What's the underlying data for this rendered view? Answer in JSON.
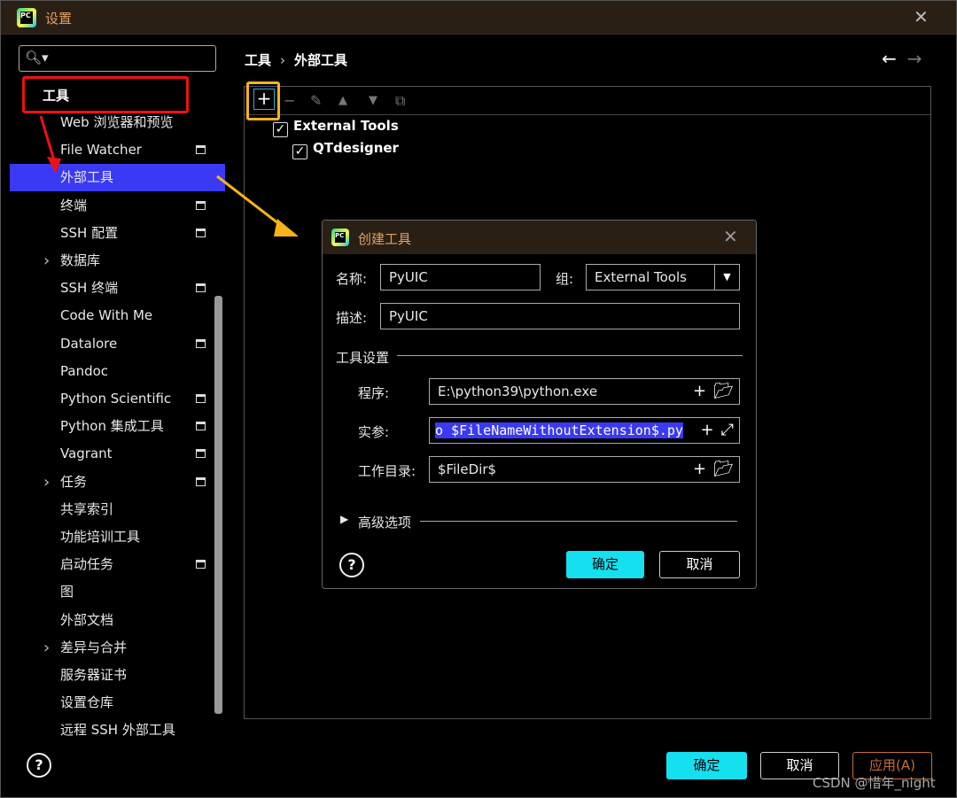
{
  "window": {
    "title": "设置",
    "close": "✕"
  },
  "search": {
    "placeholder": "",
    "icon": "search-icon"
  },
  "sidebar": {
    "heading": "工具",
    "items": [
      {
        "label": "Web 浏览器和预览",
        "chev": false,
        "badge": false
      },
      {
        "label": "File Watcher",
        "chev": false,
        "badge": true
      },
      {
        "label": "外部工具",
        "chev": false,
        "badge": false,
        "selected": true
      },
      {
        "label": "终端",
        "chev": false,
        "badge": true
      },
      {
        "label": "SSH 配置",
        "chev": false,
        "badge": true
      },
      {
        "label": "数据库",
        "chev": true,
        "badge": false
      },
      {
        "label": "SSH 终端",
        "chev": false,
        "badge": true
      },
      {
        "label": "Code With Me",
        "chev": false,
        "badge": false
      },
      {
        "label": "Datalore",
        "chev": false,
        "badge": true
      },
      {
        "label": "Pandoc",
        "chev": false,
        "badge": false
      },
      {
        "label": "Python Scientific",
        "chev": false,
        "badge": true
      },
      {
        "label": "Python 集成工具",
        "chev": false,
        "badge": true
      },
      {
        "label": "Vagrant",
        "chev": false,
        "badge": true
      },
      {
        "label": "任务",
        "chev": true,
        "badge": true
      },
      {
        "label": "共享索引",
        "chev": false,
        "badge": false
      },
      {
        "label": "功能培训工具",
        "chev": false,
        "badge": false
      },
      {
        "label": "启动任务",
        "chev": false,
        "badge": true
      },
      {
        "label": "图",
        "chev": false,
        "badge": false
      },
      {
        "label": "外部文档",
        "chev": false,
        "badge": false
      },
      {
        "label": "差异与合并",
        "chev": true,
        "badge": false
      },
      {
        "label": "服务器证书",
        "chev": false,
        "badge": false
      },
      {
        "label": "设置仓库",
        "chev": false,
        "badge": false
      },
      {
        "label": "远程 SSH 外部工具",
        "chev": false,
        "badge": false
      }
    ]
  },
  "breadcrumb": {
    "parent": "工具",
    "separator": "›",
    "current": "外部工具"
  },
  "nav": {
    "back": "←",
    "forward": "→"
  },
  "toolbar": {
    "add": "+",
    "remove": "−",
    "edit": "✎",
    "up": "▲",
    "down": "▼",
    "copy": "⧉"
  },
  "tree": {
    "group": "External Tools",
    "child": "QTdesigner",
    "check": "✓"
  },
  "dialog": {
    "title": "创建工具",
    "name_label": "名称:",
    "name_value": "PyUIC",
    "group_label": "组:",
    "group_value": "External Tools",
    "desc_label": "描述:",
    "desc_value": "PyUIC",
    "section": "工具设置",
    "program_label": "程序:",
    "program_value": "E:\\python39\\python.exe",
    "args_label": "实参:",
    "args_value": "o $FileNameWithoutExtension$.py",
    "workdir_label": "工作目录:",
    "workdir_value": "$FileDir$",
    "advanced": "高级选项",
    "ok": "确定",
    "cancel": "取消",
    "help": "?"
  },
  "footer": {
    "help": "?",
    "ok": "确定",
    "cancel": "取消",
    "apply": "应用(A)"
  },
  "watermark": "CSDN @惜年_night",
  "colors": {
    "selection": "#3a3af5",
    "primary_button": "#14e0f0",
    "red_highlight": "#f01010",
    "orange_highlight": "#f7b318"
  }
}
